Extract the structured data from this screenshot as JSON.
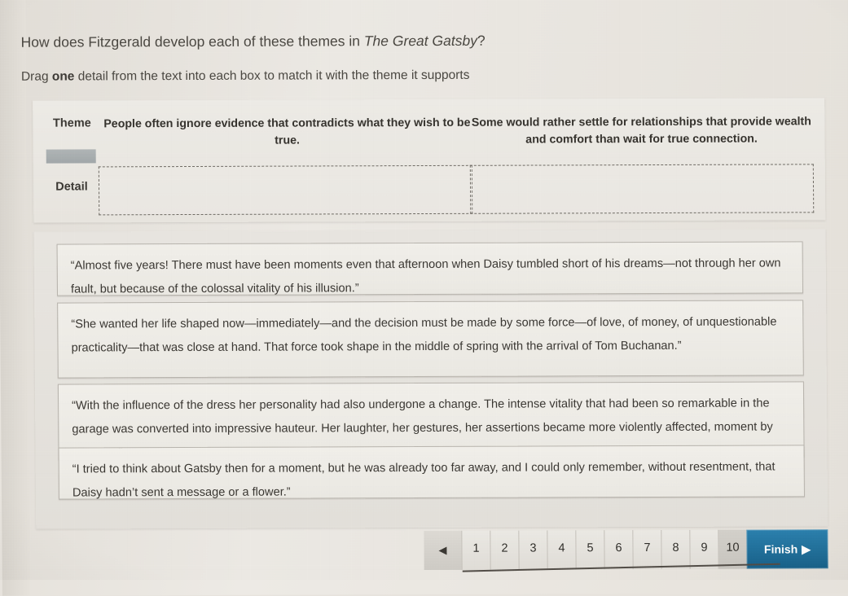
{
  "question": {
    "title_before": "How does Fitzgerald develop each of these themes in ",
    "title_italic": "The Great Gatsby",
    "title_after": "?",
    "instruction_before": "Drag ",
    "instruction_bold": "one",
    "instruction_after": " detail from the text into each box to match it with the theme it supports"
  },
  "matrix": {
    "theme_label": "Theme",
    "detail_label": "Detail",
    "themes": [
      "People often ignore evidence that contradicts what they wish to be true.",
      "Some would rather settle for relationships that provide wealth and comfort than wait for true connection."
    ],
    "dropzones": [
      "",
      ""
    ]
  },
  "choices": [
    "“Almost five years! There must have been moments even that afternoon when Daisy tumbled short of his dreams—not through her own fault, but because of the colossal vitality of his illusion.”",
    "“She wanted her life shaped now—immediately—and the decision must be made by some force—of love, of money, of unquestionable practicality—that was close at hand. That force took shape in the middle of spring with the arrival of Tom Buchanan.”",
    "“With the influence of the dress her personality had also undergone a change. The intense vitality that had been so remarkable in the garage was converted into impressive hauteur. Her laughter, her gestures, her assertions became more violently affected, moment by moment.”",
    "“I tried to think about Gatsby then for a moment, but he was already too far away, and I could only remember, without resentment, that Daisy hadn’t sent a message or a flower.”"
  ],
  "pagination": {
    "back_icon": "◀",
    "pages": [
      "1",
      "2",
      "3",
      "4",
      "5",
      "6",
      "7",
      "8",
      "9",
      "10"
    ],
    "current_page": "10",
    "finish_label": "Finish",
    "finish_icon": "▶"
  },
  "colors": {
    "page_background": "#e7e3dd",
    "panel": "#eceae4",
    "text": "#3a3732",
    "dashed_border": "#6f6b64",
    "chip_gray": "#a8aeb0",
    "finish_blue": "#1f6f9c"
  }
}
